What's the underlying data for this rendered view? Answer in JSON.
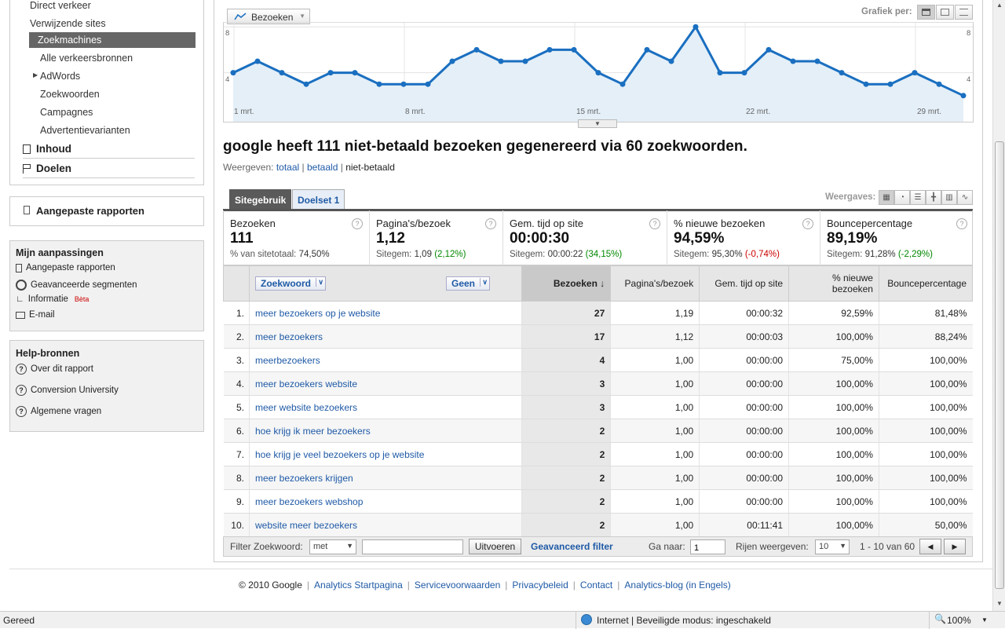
{
  "sidebar": {
    "nav_items": [
      "Direct verkeer",
      "Verwijzende sites",
      "Zoekmachines",
      "Alle verkeersbronnen",
      "AdWords",
      "Zoekwoorden",
      "Campagnes",
      "Advertentievarianten"
    ],
    "sections": [
      "Inhoud",
      "Doelen"
    ],
    "custom_reports": "Aangepaste rapporten",
    "mine": {
      "title": "Mijn aanpassingen",
      "items": [
        "Aangepaste rapporten",
        "Geavanceerde segmenten",
        "Informatie",
        "E-mail"
      ],
      "beta": "Bèta"
    },
    "help": {
      "title": "Help-bronnen",
      "items": [
        "Over dit rapport",
        "Conversion University",
        "Algemene vragen"
      ]
    }
  },
  "chart": {
    "metric": "Bezoeken",
    "grafiek_label": "Grafiek per:",
    "y_ticks": [
      "8",
      "4"
    ],
    "x_labels": [
      "1 mrt.",
      "8 mrt.",
      "15 mrt.",
      "22 mrt.",
      "29 mrt."
    ]
  },
  "chart_data": {
    "type": "area",
    "series": [
      {
        "name": "Bezoeken",
        "values": [
          4,
          5,
          4,
          3,
          4,
          4,
          3,
          3,
          3,
          5,
          6,
          5,
          5,
          6,
          6,
          4,
          3,
          6,
          5,
          8,
          4,
          4,
          6,
          5,
          5,
          4,
          3,
          3,
          4,
          3,
          2
        ]
      }
    ],
    "ylim": [
      0,
      10
    ],
    "x_ticks": [
      "1 mrt.",
      "8 mrt.",
      "15 mrt.",
      "22 mrt.",
      "29 mrt."
    ],
    "grid": true
  },
  "headline": "google heeft 111 niet-betaald bezoeken gegenereerd via 60 zoekwoorden.",
  "view": {
    "label": "Weergeven:",
    "totaal": "totaal",
    "betaald": "betaald",
    "current": "niet-betaald",
    "sep": "|"
  },
  "tabs": [
    "Sitegebruik",
    "Doelset 1"
  ],
  "weergaves_label": "Weergaves:",
  "scorecards": [
    {
      "label": "Bezoeken",
      "value": "111",
      "sub_prefix": "% van sitetotaal:",
      "sub_value": "74,50%",
      "sub_change": ""
    },
    {
      "label": "Pagina's/bezoek",
      "value": "1,12",
      "sub_prefix": "Sitegem:",
      "sub_value": "1,09",
      "sub_change": "(2,12%)"
    },
    {
      "label": "Gem. tijd op site",
      "value": "00:00:30",
      "sub_prefix": "Sitegem:",
      "sub_value": "00:00:22",
      "sub_change": "(34,15%)"
    },
    {
      "label": "% nieuwe bezoeken",
      "value": "94,59%",
      "sub_prefix": "Sitegem:",
      "sub_value": "95,30%",
      "sub_change": "(-0,74%)"
    },
    {
      "label": "Bouncepercentage",
      "value": "89,19%",
      "sub_prefix": "Sitegem:",
      "sub_value": "91,28%",
      "sub_change": "(-2,29%)"
    }
  ],
  "table": {
    "dim_label": "Zoekwoord",
    "secondary_label": "Geen",
    "columns": [
      "Bezoeken",
      "Pagina's/bezoek",
      "Gem. tijd op site",
      "% nieuwe bezoeken",
      "Bouncepercentage"
    ],
    "rows": [
      [
        "1.",
        "meer bezoekers op je website",
        "27",
        "1,19",
        "00:00:32",
        "92,59%",
        "81,48%"
      ],
      [
        "2.",
        "meer bezoekers",
        "17",
        "1,12",
        "00:00:03",
        "100,00%",
        "88,24%"
      ],
      [
        "3.",
        "meerbezoekers",
        "4",
        "1,00",
        "00:00:00",
        "75,00%",
        "100,00%"
      ],
      [
        "4.",
        "meer bezoekers website",
        "3",
        "1,00",
        "00:00:00",
        "100,00%",
        "100,00%"
      ],
      [
        "5.",
        "meer website bezoekers",
        "3",
        "1,00",
        "00:00:00",
        "100,00%",
        "100,00%"
      ],
      [
        "6.",
        "hoe krijg ik meer bezoekers",
        "2",
        "1,00",
        "00:00:00",
        "100,00%",
        "100,00%"
      ],
      [
        "7.",
        "hoe krijg je veel bezoekers op je website",
        "2",
        "1,00",
        "00:00:00",
        "100,00%",
        "100,00%"
      ],
      [
        "8.",
        "meer bezoekers krijgen",
        "2",
        "1,00",
        "00:00:00",
        "100,00%",
        "100,00%"
      ],
      [
        "9.",
        "meer bezoekers webshop",
        "2",
        "1,00",
        "00:00:00",
        "100,00%",
        "100,00%"
      ],
      [
        "10.",
        "website meer bezoekers",
        "2",
        "1,00",
        "00:11:41",
        "100,00%",
        "50,00%"
      ]
    ]
  },
  "filter": {
    "label": "Filter Zoekwoord:",
    "mode": "met",
    "input_value": "",
    "apply": "Uitvoeren",
    "advanced": "Geavanceerd filter",
    "goto_label": "Ga naar:",
    "goto_value": "1",
    "rows_label": "Rijen weergeven:",
    "rows_value": "10",
    "range": "1 - 10 van 60"
  },
  "footer": {
    "copyright": "© 2010 Google",
    "links": [
      "Analytics Startpagina",
      "Servicevoorwaarden",
      "Privacybeleid",
      "Contact",
      "Analytics-blog (in Engels)"
    ]
  },
  "statusbar": {
    "left": "Gereed",
    "zone": "Internet | Beveiligde modus: ingeschakeld",
    "zoom": "100%"
  },
  "colors": {
    "link": "#1f5aa6",
    "chart_line": "#1a6fc0",
    "chart_fill": "#e4eff8",
    "positive": "#008800",
    "negative": "#cc0000"
  }
}
